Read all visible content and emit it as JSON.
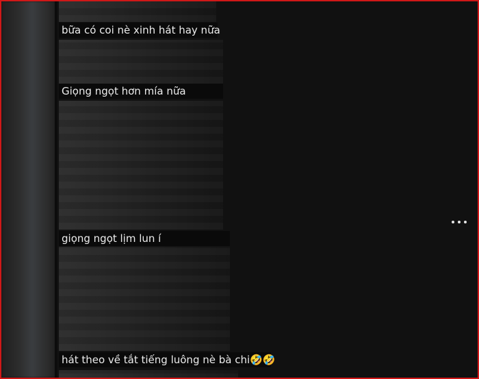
{
  "comments": [
    {
      "text": "bữa có coi nè xinh hát hay nữa"
    },
    {
      "text": "Giọng ngọt hơn mía nữa"
    },
    {
      "text": "giọng ngọt lịm lun í"
    },
    {
      "text": "hát theo về tắt tiếng luông nè bà chi🤣🤣"
    }
  ],
  "icons": {
    "more": "more-horizontal-icon"
  }
}
